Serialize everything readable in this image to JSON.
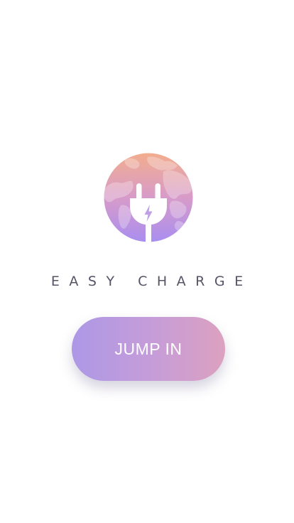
{
  "brand": {
    "title": "EASY CHARGE",
    "logo_icon": "globe-plug-icon",
    "gradient": {
      "top": "#f2ad8e",
      "middle": "#d79bc9",
      "bottom": "#a98ef0"
    }
  },
  "actions": {
    "primary_label": "JUMP IN",
    "primary_gradient": [
      "#ad98e6",
      "#dca1bf"
    ]
  }
}
